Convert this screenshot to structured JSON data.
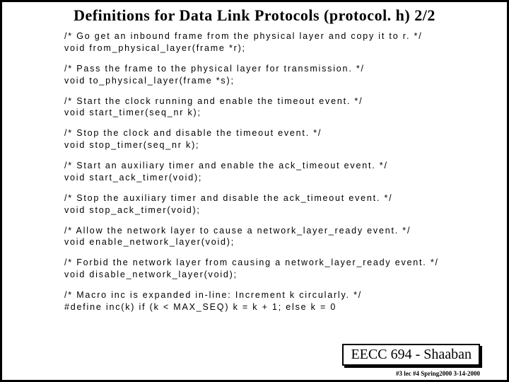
{
  "title": "Definitions for Data Link Protocols  (protocol. h) 2/2",
  "blocks": [
    {
      "comment": "/* Go get an inbound frame from the physical layer and copy it to r. */",
      "sig": "void from_physical_layer(frame *r);"
    },
    {
      "comment": "/* Pass the frame to the physical layer for transmission. */",
      "sig": "void to_physical_layer(frame *s);"
    },
    {
      "comment": "/* Start the clock running and enable the timeout event. */",
      "sig": "void start_timer(seq_nr k);"
    },
    {
      "comment": "/* Stop the clock and disable the timeout event. */",
      "sig": "void stop_timer(seq_nr k);"
    },
    {
      "comment": "/* Start an auxiliary timer and enable the ack_timeout event. */",
      "sig": "void start_ack_timer(void);"
    },
    {
      "comment": "/* Stop the auxiliary timer and disable the ack_timeout event. */",
      "sig": "void stop_ack_timer(void);"
    },
    {
      "comment": "/* Allow the network layer to cause a network_layer_ready event. */",
      "sig": "void enable_network_layer(void);"
    },
    {
      "comment": "/* Forbid the network layer from causing a network_layer_ready event. */",
      "sig": "void disable_network_layer(void);"
    },
    {
      "comment": "/* Macro inc is expanded in-line: Increment k circularly. */",
      "sig": "#define inc(k) if (k < MAX_SEQ) k = k + 1; else k = 0"
    }
  ],
  "footer": "EECC 694 - Shaaban",
  "subfooter": "#3 lec #4  Spring2000  3-14-2000"
}
